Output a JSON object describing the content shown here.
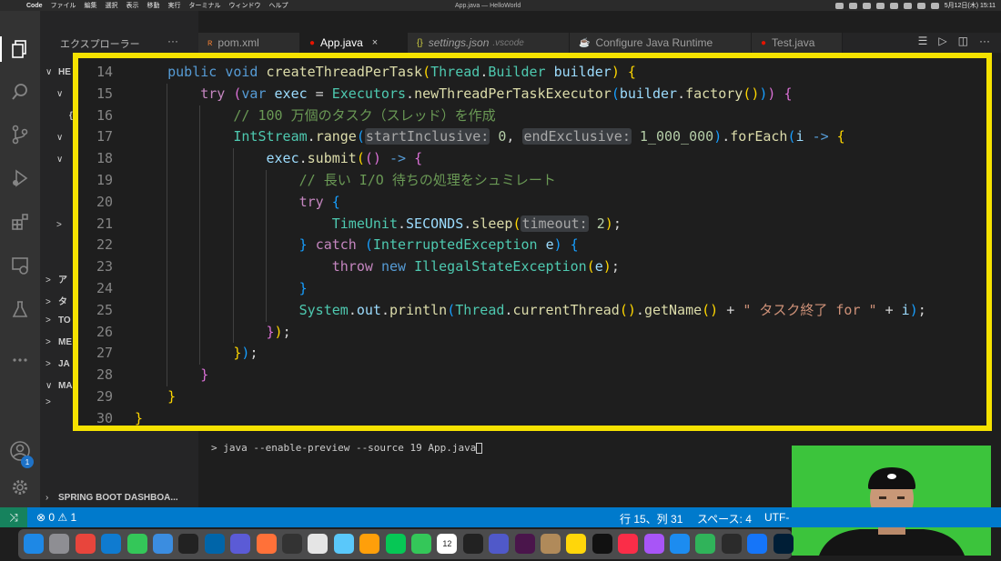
{
  "menubar": {
    "app_name": "Code",
    "menus": [
      "ファイル",
      "編集",
      "選択",
      "表示",
      "移動",
      "実行",
      "ターミナル",
      "ウィンドウ",
      "ヘルプ"
    ],
    "window_title": "App.java — HelloWorld",
    "date_time": "5月12日(木) 15:11"
  },
  "sidebar": {
    "header": "エクスプローラー",
    "more": "···",
    "rows": [
      {
        "label": "HE",
        "chevron": "∨"
      },
      {
        "label": "",
        "chevron": "∨"
      },
      {
        "label": "{}",
        "chevron": ""
      },
      {
        "label": "",
        "chevron": "∨"
      },
      {
        "label": "",
        "chevron": "∨"
      },
      {
        "label": "",
        "chevron": ""
      },
      {
        "label": "",
        "chevron": ""
      },
      {
        "label": "",
        "chevron": ">"
      },
      {
        "label": "",
        "chevron": ""
      },
      {
        "label": "ア",
        "chevron": ">"
      },
      {
        "label": "タ",
        "chevron": ">"
      },
      {
        "label": "TO",
        "chevron": ">"
      },
      {
        "label": "ME",
        "chevron": ">"
      },
      {
        "label": "JA",
        "chevron": ">"
      },
      {
        "label": "MA",
        "chevron": "∨"
      },
      {
        "label": "",
        "chevron": ">"
      }
    ],
    "bottom_section": "SPRING BOOT DASHBOA..."
  },
  "activity": {
    "badge": "1"
  },
  "tabs": [
    {
      "label": "pom.xml",
      "icon": "ʀ",
      "icon_color": "#e37933",
      "sub": ""
    },
    {
      "label": "App.java",
      "icon": "●",
      "icon_color": "#e51400",
      "sub": "",
      "close": "×",
      "active": true
    },
    {
      "label": "settings.json",
      "icon": "{}",
      "icon_color": "#cbcb41",
      "sub": ".vscode"
    },
    {
      "label": "Configure Java Runtime",
      "icon": "☕",
      "icon_color": "#cccccc",
      "sub": ""
    },
    {
      "label": "Test.java",
      "icon": "●",
      "icon_color": "#e51400",
      "sub": ""
    }
  ],
  "editor": {
    "line_numbers": [
      "14",
      "15",
      "16",
      "17",
      "18",
      "19",
      "20",
      "21",
      "22",
      "23",
      "24",
      "25",
      "26",
      "27",
      "28",
      "29",
      "30"
    ],
    "lines": [
      [
        [
          "",
          "    "
        ],
        [
          "kw",
          "public "
        ],
        [
          "kw",
          "void "
        ],
        [
          "fn",
          "createThreadPerTask"
        ],
        [
          "br1",
          "("
        ],
        [
          "ty",
          "Thread"
        ],
        [
          "pu",
          "."
        ],
        [
          "ty",
          "Builder "
        ],
        [
          "va",
          "builder"
        ],
        [
          "br1",
          ")"
        ],
        [
          "pu",
          " "
        ],
        [
          "br1",
          "{"
        ]
      ],
      [
        [
          "",
          "        "
        ],
        [
          "ctl",
          "try "
        ],
        [
          "br2",
          "("
        ],
        [
          "kw",
          "var "
        ],
        [
          "va",
          "exec"
        ],
        [
          "pu",
          " = "
        ],
        [
          "ty",
          "Executors"
        ],
        [
          "pu",
          "."
        ],
        [
          "fn",
          "newThreadPerTaskExecutor"
        ],
        [
          "br3",
          "("
        ],
        [
          "va",
          "builder"
        ],
        [
          "pu",
          "."
        ],
        [
          "fn",
          "factory"
        ],
        [
          "br1",
          "()"
        ],
        [
          "br3",
          ")"
        ],
        [
          "br2",
          ")"
        ],
        [
          "pu",
          " "
        ],
        [
          "br2",
          "{"
        ]
      ],
      [
        [
          "",
          "            "
        ],
        [
          "cm",
          "// 100 万個のタスク（スレッド）を作成"
        ]
      ],
      [
        [
          "",
          "            "
        ],
        [
          "ty",
          "IntStream"
        ],
        [
          "pu",
          "."
        ],
        [
          "fn",
          "range"
        ],
        [
          "br3",
          "("
        ],
        [
          "hint",
          "startInclusive:"
        ],
        [
          "pu",
          " "
        ],
        [
          "nu",
          "0"
        ],
        [
          "pu",
          ", "
        ],
        [
          "hint",
          "endExclusive:"
        ],
        [
          "pu",
          " "
        ],
        [
          "nu",
          "1_000_000"
        ],
        [
          "br3",
          ")"
        ],
        [
          "pu",
          "."
        ],
        [
          "fn",
          "forEach"
        ],
        [
          "br3",
          "("
        ],
        [
          "va",
          "i"
        ],
        [
          "pu",
          " "
        ],
        [
          "kw",
          "->"
        ],
        [
          "pu",
          " "
        ],
        [
          "br1",
          "{"
        ]
      ],
      [
        [
          "",
          "                "
        ],
        [
          "va",
          "exec"
        ],
        [
          "pu",
          "."
        ],
        [
          "fn",
          "submit"
        ],
        [
          "br1",
          "("
        ],
        [
          "br2",
          "()"
        ],
        [
          "pu",
          " "
        ],
        [
          "kw",
          "->"
        ],
        [
          "pu",
          " "
        ],
        [
          "br2",
          "{"
        ]
      ],
      [
        [
          "",
          "                    "
        ],
        [
          "cm",
          "// 長い I/O 待ちの処理をシュミレート"
        ]
      ],
      [
        [
          "",
          "                    "
        ],
        [
          "ctl",
          "try "
        ],
        [
          "br3",
          "{"
        ]
      ],
      [
        [
          "",
          "                        "
        ],
        [
          "ty",
          "TimeUnit"
        ],
        [
          "pu",
          "."
        ],
        [
          "va",
          "SECONDS"
        ],
        [
          "pu",
          "."
        ],
        [
          "fn",
          "sleep"
        ],
        [
          "br1",
          "("
        ],
        [
          "hint",
          "timeout:"
        ],
        [
          "pu",
          " "
        ],
        [
          "nu",
          "2"
        ],
        [
          "br1",
          ")"
        ],
        [
          "pu",
          ";"
        ]
      ],
      [
        [
          "",
          "                    "
        ],
        [
          "br3",
          "}"
        ],
        [
          "pu",
          " "
        ],
        [
          "ctl",
          "catch "
        ],
        [
          "br3",
          "("
        ],
        [
          "ty",
          "InterruptedException "
        ],
        [
          "va",
          "e"
        ],
        [
          "br3",
          ")"
        ],
        [
          "pu",
          " "
        ],
        [
          "br3",
          "{"
        ]
      ],
      [
        [
          "",
          "                        "
        ],
        [
          "ctl",
          "throw "
        ],
        [
          "kw",
          "new "
        ],
        [
          "ty",
          "IllegalStateException"
        ],
        [
          "br1",
          "("
        ],
        [
          "va",
          "e"
        ],
        [
          "br1",
          ")"
        ],
        [
          "pu",
          ";"
        ]
      ],
      [
        [
          "",
          "                    "
        ],
        [
          "br3",
          "}"
        ]
      ],
      [
        [
          "",
          "                    "
        ],
        [
          "ty",
          "System"
        ],
        [
          "pu",
          "."
        ],
        [
          "va",
          "out"
        ],
        [
          "pu",
          "."
        ],
        [
          "fn",
          "println"
        ],
        [
          "br3",
          "("
        ],
        [
          "ty",
          "Thread"
        ],
        [
          "pu",
          "."
        ],
        [
          "fn",
          "currentThread"
        ],
        [
          "br1",
          "()"
        ],
        [
          "pu",
          "."
        ],
        [
          "fn",
          "getName"
        ],
        [
          "br1",
          "()"
        ],
        [
          "pu",
          " + "
        ],
        [
          "st",
          "\" タスク終了 for \""
        ],
        [
          "pu",
          " + "
        ],
        [
          "va",
          "i"
        ],
        [
          "br3",
          ")"
        ],
        [
          "pu",
          ";"
        ]
      ],
      [
        [
          "",
          "                "
        ],
        [
          "br2",
          "}"
        ],
        [
          "br1",
          ")"
        ],
        [
          "pu",
          ";"
        ]
      ],
      [
        [
          "",
          "            "
        ],
        [
          "br1",
          "}"
        ],
        [
          "br3",
          ")"
        ],
        [
          "pu",
          ";"
        ]
      ],
      [
        [
          "",
          "        "
        ],
        [
          "br2",
          "}"
        ]
      ],
      [
        [
          "",
          "    "
        ],
        [
          "br1",
          "}"
        ]
      ],
      [
        [
          "br1",
          "}"
        ]
      ]
    ]
  },
  "terminal": {
    "command": "> java --enable-preview --source 19 App.java"
  },
  "statusbar": {
    "remote_icon": "⤨",
    "problems": "⊗ 0 ⚠ 1",
    "position": "行 15、列 31",
    "indent": "スペース: 4",
    "encoding": "UTF-"
  },
  "dock": {
    "apps": [
      "finder",
      "launchpad",
      "chrome",
      "edge",
      "messages",
      "mail",
      "terminal",
      "vscode",
      "other",
      "firefox",
      "github",
      "notes",
      "maps",
      "photos",
      "line",
      "facetime",
      "calendar",
      "sketch",
      "teams",
      "slack",
      "contacts",
      "notes-yellow",
      "tv",
      "music",
      "podcasts",
      "appstore",
      "numbers",
      "activity",
      "xcode",
      "photoshop"
    ],
    "calendar_day": "12"
  }
}
